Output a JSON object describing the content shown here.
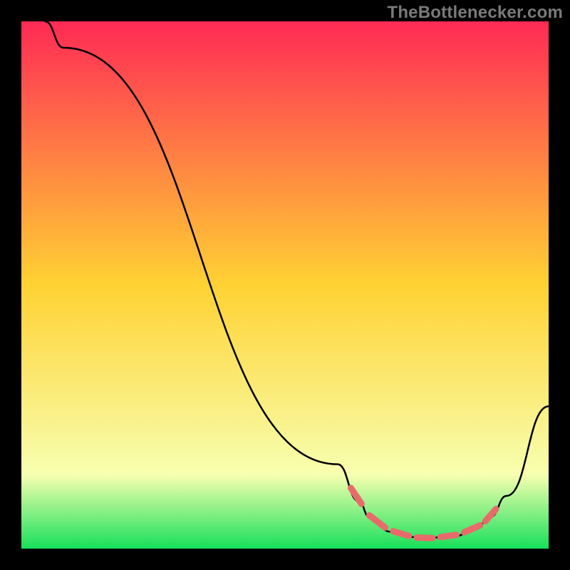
{
  "watermark": "TheBottlenecker.com",
  "colors": {
    "bg": "#000000",
    "grad_top": "#ff2a55",
    "grad_mid": "#ffd233",
    "grad_lowpale": "#f7ffb0",
    "grad_base": "#18e05a",
    "curve": "#000000",
    "marker": "#e86b6b"
  },
  "chart_data": {
    "type": "line",
    "title": "",
    "xlabel": "",
    "ylabel": "",
    "xlim": [
      0,
      100
    ],
    "ylim": [
      0,
      100
    ],
    "series": [
      {
        "name": "bottleneck-curve",
        "stroke": "curve",
        "points": [
          {
            "x": 4.5,
            "y": 100
          },
          {
            "x": 8,
            "y": 95
          },
          {
            "x": 60,
            "y": 16
          },
          {
            "x": 64,
            "y": 9
          },
          {
            "x": 66,
            "y": 6
          },
          {
            "x": 70,
            "y": 3.2
          },
          {
            "x": 74,
            "y": 2.2
          },
          {
            "x": 78,
            "y": 2.1
          },
          {
            "x": 82,
            "y": 2.3
          },
          {
            "x": 86,
            "y": 3.6
          },
          {
            "x": 89,
            "y": 6
          },
          {
            "x": 92,
            "y": 10
          },
          {
            "x": 100,
            "y": 27
          }
        ]
      }
    ],
    "markers": [
      {
        "x1": 62.5,
        "y1": 11.5,
        "x2": 64.5,
        "y2": 8.5
      },
      {
        "x1": 66.0,
        "y1": 6.3,
        "x2": 69.0,
        "y2": 4.0
      },
      {
        "x1": 70.5,
        "y1": 3.3,
        "x2": 73.5,
        "y2": 2.4
      },
      {
        "x1": 75.0,
        "y1": 2.1,
        "x2": 78.0,
        "y2": 2.0
      },
      {
        "x1": 79.5,
        "y1": 2.2,
        "x2": 82.5,
        "y2": 2.6
      },
      {
        "x1": 84.0,
        "y1": 3.1,
        "x2": 87.0,
        "y2": 4.4
      },
      {
        "x1": 88.0,
        "y1": 5.2,
        "x2": 90.0,
        "y2": 7.5
      }
    ]
  }
}
